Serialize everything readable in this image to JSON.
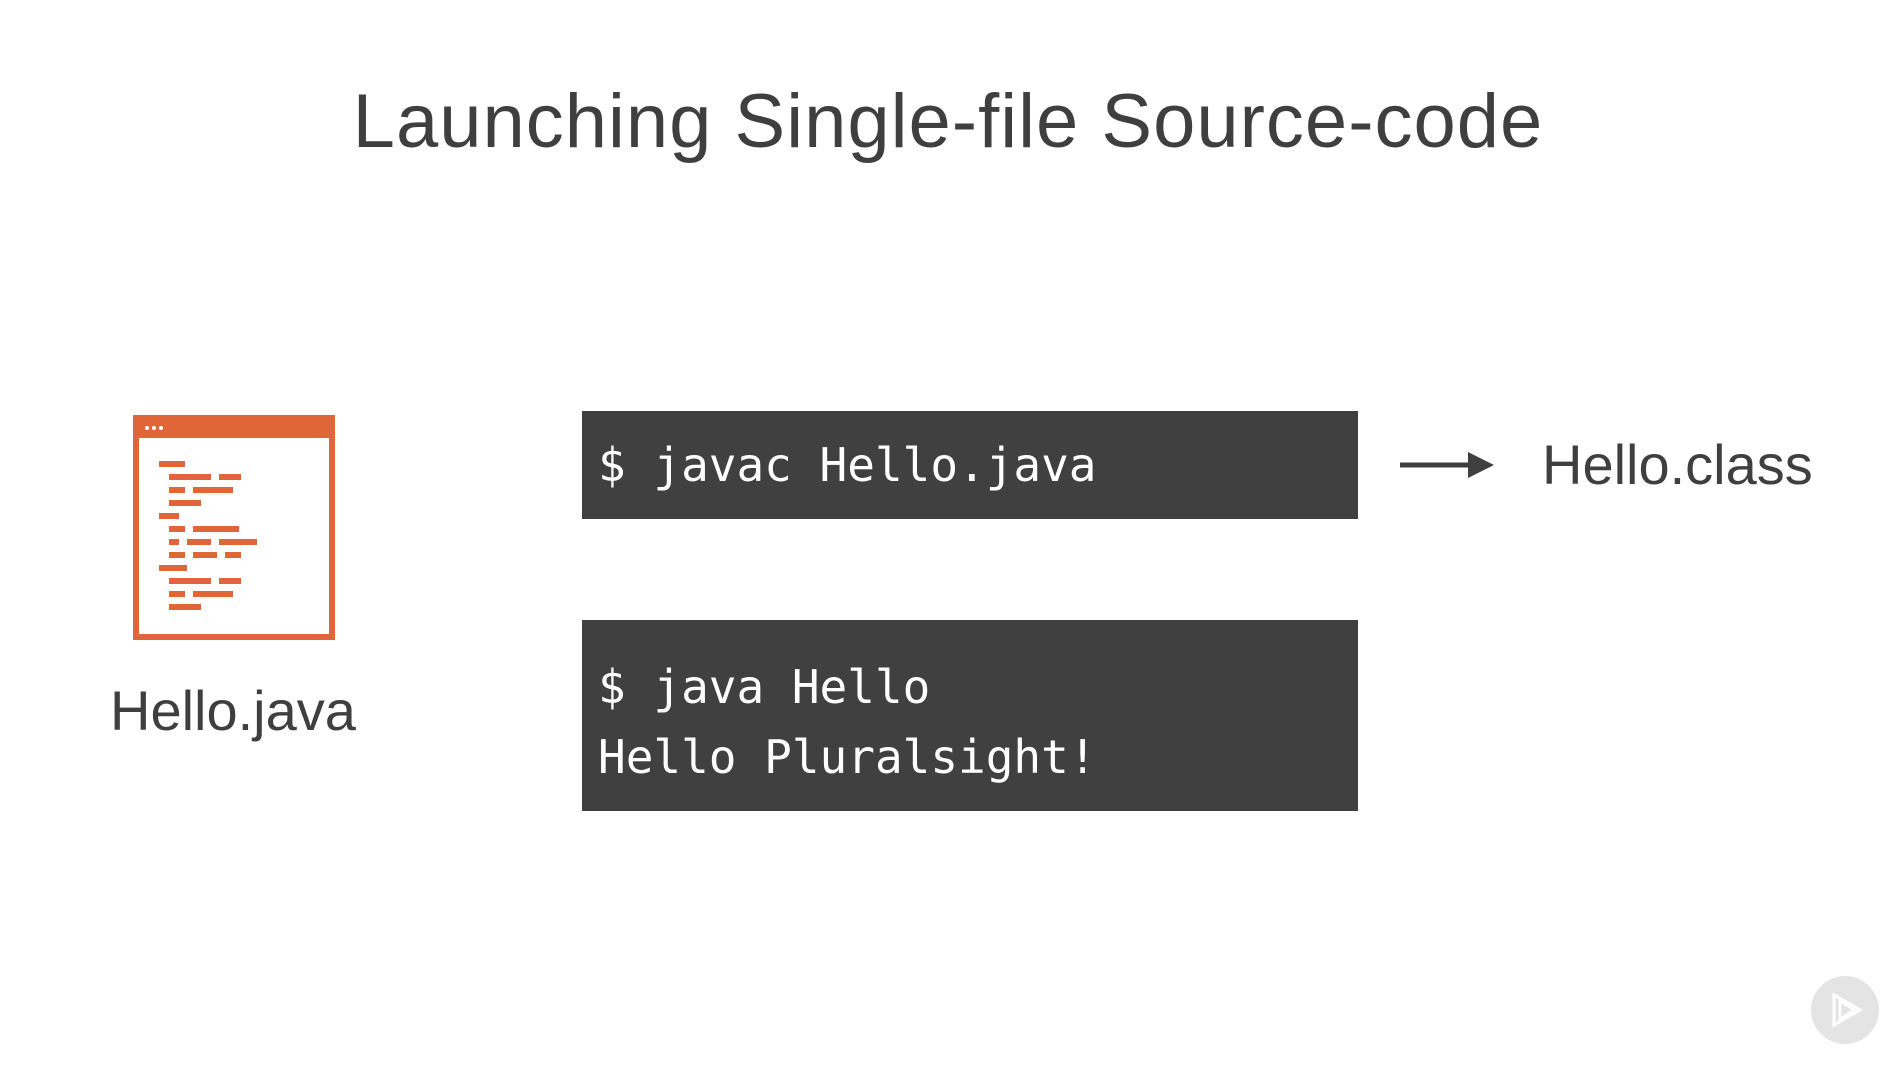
{
  "slide": {
    "title": "Launching Single-file Source-code"
  },
  "source_file": {
    "icon": "code-file-icon",
    "label": "Hello.java",
    "accent_color": "#e0663a"
  },
  "compile_terminal": {
    "command": "$ javac Hello.java"
  },
  "run_terminal": {
    "command": "$ java Hello",
    "output": "Hello Pluralsight!"
  },
  "output_file": {
    "arrow_icon": "arrow-right-icon",
    "label": "Hello.class"
  },
  "branding": {
    "icon": "pluralsight-play-icon"
  },
  "colors": {
    "terminal_bg": "#404040",
    "text": "#3f3f3f"
  }
}
